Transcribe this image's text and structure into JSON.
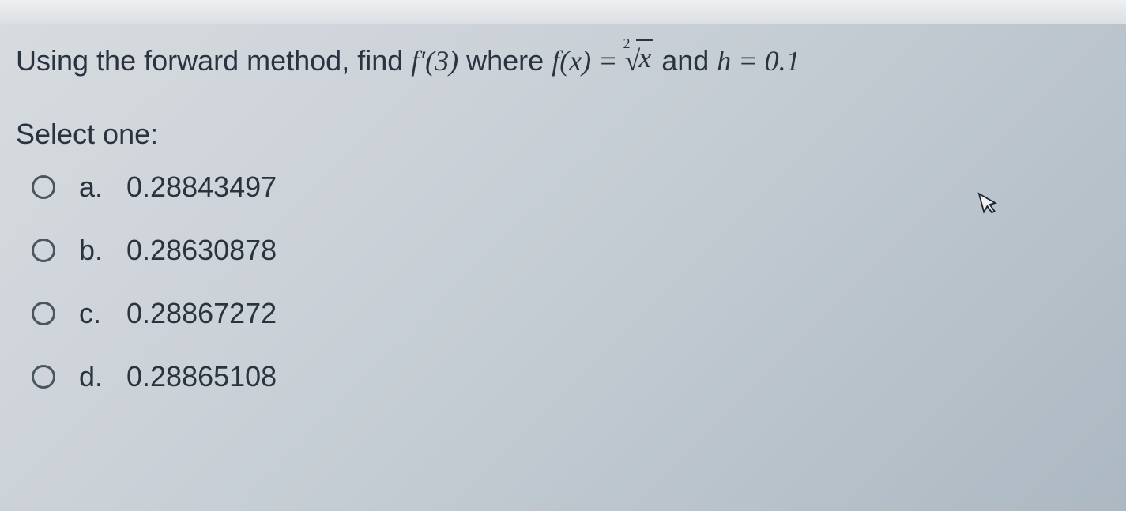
{
  "question": {
    "prefix": "Using the forward method, find ",
    "fprime": "f′(3)",
    "where": " where ",
    "fx": "f(x) = ",
    "root_index": "2",
    "root_arg": "x",
    "and_h": " and ",
    "h_eq": "h = 0.1"
  },
  "select_prompt": "Select one:",
  "options": [
    {
      "label": "a.",
      "value": "0.28843497"
    },
    {
      "label": "b.",
      "value": "0.28630878"
    },
    {
      "label": "c.",
      "value": "0.28867272"
    },
    {
      "label": "d.",
      "value": "0.28865108"
    }
  ]
}
